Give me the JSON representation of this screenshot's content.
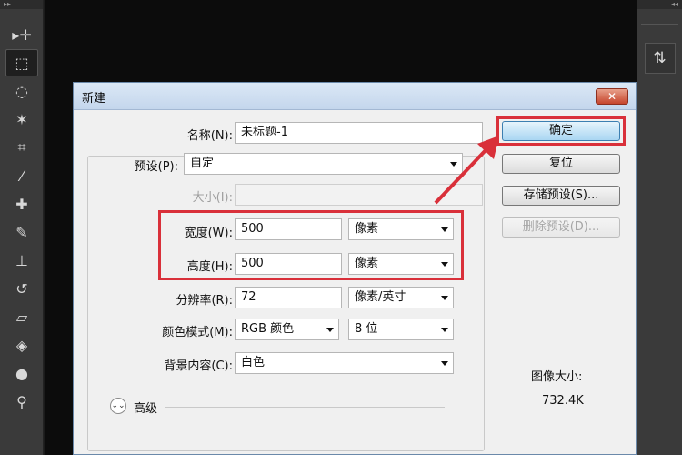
{
  "dialog": {
    "title": "新建",
    "close_label": "✕",
    "fields": {
      "name_label": "名称(N):",
      "name_value": "未标题-1",
      "preset_label": "预设(P):",
      "preset_value": "自定",
      "size_label": "大小(I):",
      "size_value": "",
      "width_label": "宽度(W):",
      "width_value": "500",
      "width_unit": "像素",
      "height_label": "高度(H):",
      "height_value": "500",
      "height_unit": "像素",
      "resolution_label": "分辨率(R):",
      "resolution_value": "72",
      "resolution_unit": "像素/英寸",
      "color_mode_label": "颜色模式(M):",
      "color_mode_value": "RGB 颜色",
      "bit_depth_value": "8 位",
      "background_label": "背景内容(C):",
      "background_value": "白色"
    },
    "advanced_label": "高级",
    "buttons": {
      "ok": "确定",
      "reset": "复位",
      "save_preset": "存储预设(S)...",
      "delete_preset": "删除预设(D)..."
    },
    "image_size_label": "图像大小:",
    "image_size_value": "732.4K"
  },
  "colors": {
    "highlight": "#d9303a",
    "primary_button": "#a9d6f2"
  },
  "icons": {
    "tools": [
      "move-icon",
      "marquee-icon",
      "lasso-icon",
      "magic-wand-icon",
      "crop-icon",
      "eyedropper-icon",
      "healing-brush-icon",
      "brush-icon",
      "clone-stamp-icon",
      "history-brush-icon",
      "eraser-icon",
      "paint-bucket-icon",
      "blur-icon",
      "dodge-icon"
    ],
    "panel": "history-panel-icon"
  }
}
